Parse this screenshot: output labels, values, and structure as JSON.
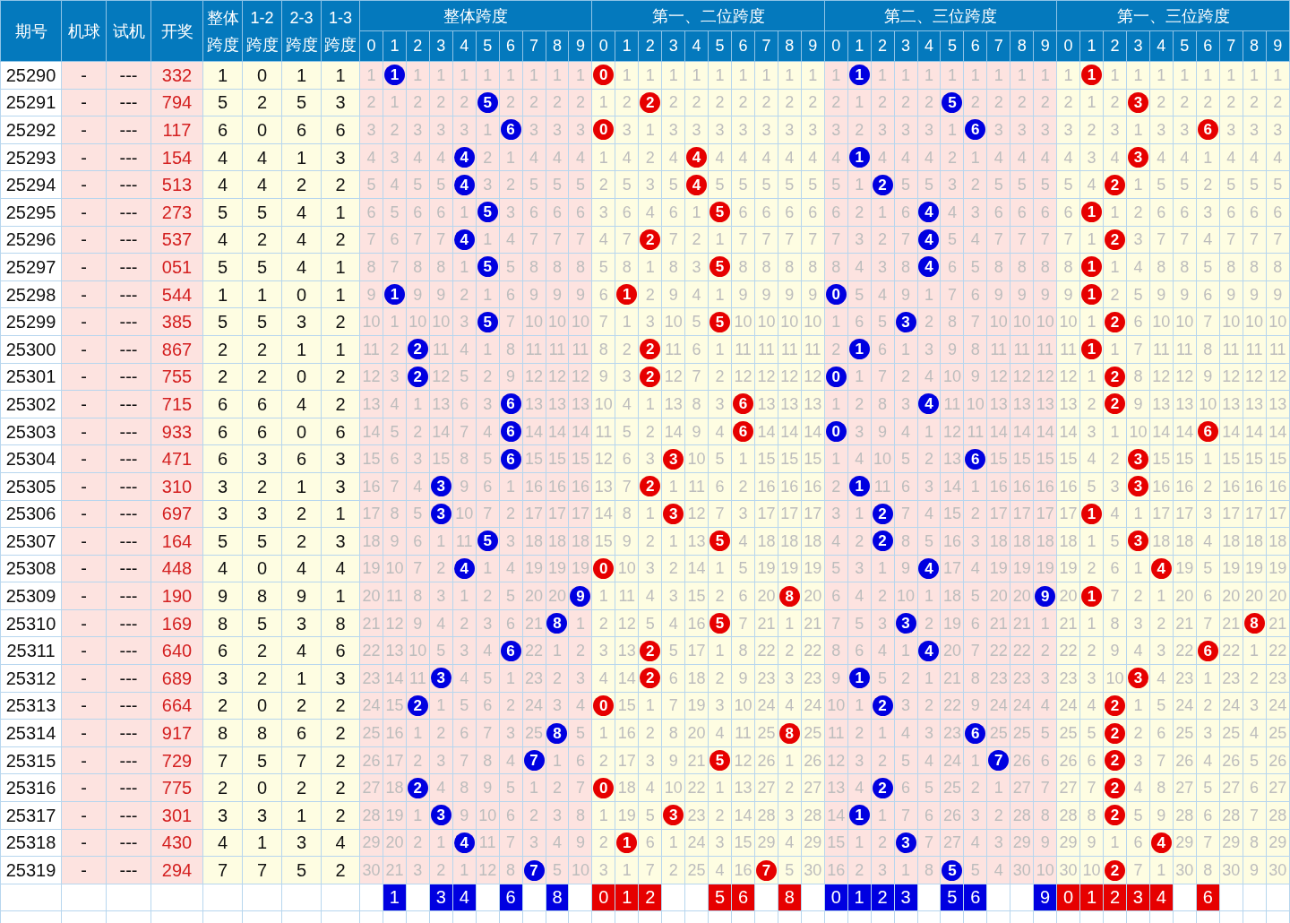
{
  "columns": [
    {
      "label": "期号"
    },
    {
      "label": "机球"
    },
    {
      "label": "试机"
    },
    {
      "label": "开奖"
    }
  ],
  "span_columns": [
    {
      "top": "整体",
      "bottom": "跨度"
    },
    {
      "top": "1-2",
      "bottom": "跨度"
    },
    {
      "top": "2-3",
      "bottom": "跨度"
    },
    {
      "top": "1-3",
      "bottom": "跨度"
    }
  ],
  "groups": [
    {
      "title": "整体跨度",
      "color": "#0000e0",
      "digits": [
        "0",
        "1",
        "2",
        "3",
        "4",
        "5",
        "6",
        "7",
        "8",
        "9"
      ],
      "picks": [
        {
          "kind": "blank"
        },
        {
          "kind": "digit",
          "digit": "1"
        },
        {
          "kind": "blank"
        },
        {
          "kind": "digit",
          "digit": "3"
        },
        {
          "kind": "digit",
          "digit": "4"
        },
        {
          "kind": "blank"
        },
        {
          "kind": "digit",
          "digit": "6"
        },
        {
          "kind": "blank"
        },
        {
          "kind": "digit",
          "digit": "8"
        },
        {
          "kind": "blank"
        }
      ]
    },
    {
      "title": "第一、二位跨度",
      "color": "#e60000",
      "digits": [
        "0",
        "1",
        "2",
        "3",
        "4",
        "5",
        "6",
        "7",
        "8",
        "9"
      ],
      "picks": [
        {
          "kind": "digit",
          "digit": "0"
        },
        {
          "kind": "digit",
          "digit": "1"
        },
        {
          "kind": "digit",
          "digit": "2"
        },
        {
          "kind": "blank"
        },
        {
          "kind": "blank"
        },
        {
          "kind": "digit",
          "digit": "5"
        },
        {
          "kind": "digit",
          "digit": "6"
        },
        {
          "kind": "blank"
        },
        {
          "kind": "digit",
          "digit": "8"
        },
        {
          "kind": "blank"
        }
      ]
    },
    {
      "title": "第二、三位跨度",
      "color": "#0000e0",
      "digits": [
        "0",
        "1",
        "2",
        "3",
        "4",
        "5",
        "6",
        "7",
        "8",
        "9"
      ],
      "picks": [
        {
          "kind": "digit",
          "digit": "0"
        },
        {
          "kind": "digit",
          "digit": "1"
        },
        {
          "kind": "digit",
          "digit": "2"
        },
        {
          "kind": "digit",
          "digit": "3"
        },
        {
          "kind": "blank"
        },
        {
          "kind": "digit",
          "digit": "5"
        },
        {
          "kind": "digit",
          "digit": "6"
        },
        {
          "kind": "blank"
        },
        {
          "kind": "blank"
        },
        {
          "kind": "digit",
          "digit": "9"
        }
      ]
    },
    {
      "title": "第一、三位跨度",
      "color": "#e60000",
      "digits": [
        "0",
        "1",
        "2",
        "3",
        "4",
        "5",
        "6",
        "7",
        "8",
        "9"
      ],
      "picks": [
        {
          "kind": "digit",
          "digit": "0"
        },
        {
          "kind": "digit",
          "digit": "1"
        },
        {
          "kind": "digit",
          "digit": "2"
        },
        {
          "kind": "digit",
          "digit": "3"
        },
        {
          "kind": "digit",
          "digit": "4"
        },
        {
          "kind": "blank"
        },
        {
          "kind": "digit",
          "digit": "6"
        },
        {
          "kind": "blank"
        },
        {
          "kind": "blank"
        },
        {
          "kind": "blank"
        }
      ]
    }
  ],
  "rows": [
    {
      "issue": "25290",
      "machine": "-",
      "test": "---",
      "draw": "332",
      "spans": [
        "1",
        "0",
        "1",
        "1"
      ],
      "g": [
        [
          "1",
          {
            "ball": "1"
          },
          "1",
          "1",
          "1",
          "1",
          "1",
          "1",
          "1",
          "1"
        ],
        [
          {
            "ball": "0"
          },
          "1",
          "1",
          "1",
          "1",
          "1",
          "1",
          "1",
          "1",
          "1"
        ],
        [
          "1",
          {
            "ball": "1"
          },
          "1",
          "1",
          "1",
          "1",
          "1",
          "1",
          "1",
          "1"
        ],
        [
          "1",
          {
            "ball": "1"
          },
          "1",
          "1",
          "1",
          "1",
          "1",
          "1",
          "1",
          "1"
        ]
      ]
    },
    {
      "issue": "25291",
      "machine": "-",
      "test": "---",
      "draw": "794",
      "spans": [
        "5",
        "2",
        "5",
        "3"
      ],
      "g": [
        [
          "2",
          "1",
          "2",
          "2",
          "2",
          {
            "ball": "5"
          },
          "2",
          "2",
          "2",
          "2"
        ],
        [
          "1",
          "2",
          {
            "ball": "2"
          },
          "2",
          "2",
          "2",
          "2",
          "2",
          "2",
          "2"
        ],
        [
          "2",
          "1",
          "2",
          "2",
          "2",
          {
            "ball": "5"
          },
          "2",
          "2",
          "2",
          "2"
        ],
        [
          "2",
          "1",
          "2",
          {
            "ball": "3"
          },
          "2",
          "2",
          "2",
          "2",
          "2",
          "2"
        ]
      ]
    },
    {
      "issue": "25292",
      "machine": "-",
      "test": "---",
      "draw": "117",
      "spans": [
        "6",
        "0",
        "6",
        "6"
      ],
      "g": [
        [
          "3",
          "2",
          "3",
          "3",
          "3",
          "1",
          {
            "ball": "6"
          },
          "3",
          "3",
          "3"
        ],
        [
          {
            "ball": "0"
          },
          "3",
          "1",
          "3",
          "3",
          "3",
          "3",
          "3",
          "3",
          "3"
        ],
        [
          "3",
          "2",
          "3",
          "3",
          "3",
          "1",
          {
            "ball": "6"
          },
          "3",
          "3",
          "3"
        ],
        [
          "3",
          "2",
          "3",
          "1",
          "3",
          "3",
          {
            "ball": "6"
          },
          "3",
          "3",
          "3"
        ]
      ]
    },
    {
      "issue": "25293",
      "machine": "-",
      "test": "---",
      "draw": "154",
      "spans": [
        "4",
        "4",
        "1",
        "3"
      ],
      "g": [
        [
          "4",
          "3",
          "4",
          "4",
          {
            "ball": "4"
          },
          "2",
          "1",
          "4",
          "4",
          "4"
        ],
        [
          "1",
          "4",
          "2",
          "4",
          {
            "ball": "4"
          },
          "4",
          "4",
          "4",
          "4",
          "4"
        ],
        [
          "4",
          {
            "ball": "1"
          },
          "4",
          "4",
          "4",
          "2",
          "1",
          "4",
          "4",
          "4"
        ],
        [
          "4",
          "3",
          "4",
          {
            "ball": "3"
          },
          "4",
          "4",
          "1",
          "4",
          "4",
          "4"
        ]
      ]
    },
    {
      "issue": "25294",
      "machine": "-",
      "test": "---",
      "draw": "513",
      "spans": [
        "4",
        "4",
        "2",
        "2"
      ],
      "g": [
        [
          "5",
          "4",
          "5",
          "5",
          {
            "ball": "4"
          },
          "3",
          "2",
          "5",
          "5",
          "5"
        ],
        [
          "2",
          "5",
          "3",
          "5",
          {
            "ball": "4"
          },
          "5",
          "5",
          "5",
          "5",
          "5"
        ],
        [
          "5",
          "1",
          {
            "ball": "2"
          },
          "5",
          "5",
          "3",
          "2",
          "5",
          "5",
          "5"
        ],
        [
          "5",
          "4",
          {
            "ball": "2"
          },
          "1",
          "5",
          "5",
          "2",
          "5",
          "5",
          "5"
        ]
      ]
    },
    {
      "issue": "25295",
      "machine": "-",
      "test": "---",
      "draw": "273",
      "spans": [
        "5",
        "5",
        "4",
        "1"
      ],
      "g": [
        [
          "6",
          "5",
          "6",
          "6",
          "1",
          {
            "ball": "5"
          },
          "3",
          "6",
          "6",
          "6"
        ],
        [
          "3",
          "6",
          "4",
          "6",
          "1",
          {
            "ball": "5"
          },
          "6",
          "6",
          "6",
          "6"
        ],
        [
          "6",
          "2",
          "1",
          "6",
          {
            "ball": "4"
          },
          "4",
          "3",
          "6",
          "6",
          "6"
        ],
        [
          "6",
          {
            "ball": "1"
          },
          "1",
          "2",
          "6",
          "6",
          "3",
          "6",
          "6",
          "6"
        ]
      ]
    },
    {
      "issue": "25296",
      "machine": "-",
      "test": "---",
      "draw": "537",
      "spans": [
        "4",
        "2",
        "4",
        "2"
      ],
      "g": [
        [
          "7",
          "6",
          "7",
          "7",
          {
            "ball": "4"
          },
          "1",
          "4",
          "7",
          "7",
          "7"
        ],
        [
          "4",
          "7",
          {
            "ball": "2"
          },
          "7",
          "2",
          "1",
          "7",
          "7",
          "7",
          "7"
        ],
        [
          "7",
          "3",
          "2",
          "7",
          {
            "ball": "4"
          },
          "5",
          "4",
          "7",
          "7",
          "7"
        ],
        [
          "7",
          "1",
          {
            "ball": "2"
          },
          "3",
          "7",
          "7",
          "4",
          "7",
          "7",
          "7"
        ]
      ]
    },
    {
      "issue": "25297",
      "machine": "-",
      "test": "---",
      "draw": "051",
      "spans": [
        "5",
        "5",
        "4",
        "1"
      ],
      "g": [
        [
          "8",
          "7",
          "8",
          "8",
          "1",
          {
            "ball": "5"
          },
          "5",
          "8",
          "8",
          "8"
        ],
        [
          "5",
          "8",
          "1",
          "8",
          "3",
          {
            "ball": "5"
          },
          "8",
          "8",
          "8",
          "8"
        ],
        [
          "8",
          "4",
          "3",
          "8",
          {
            "ball": "4"
          },
          "6",
          "5",
          "8",
          "8",
          "8"
        ],
        [
          "8",
          {
            "ball": "1"
          },
          "1",
          "4",
          "8",
          "8",
          "5",
          "8",
          "8",
          "8"
        ]
      ]
    },
    {
      "issue": "25298",
      "machine": "-",
      "test": "---",
      "draw": "544",
      "spans": [
        "1",
        "1",
        "0",
        "1"
      ],
      "g": [
        [
          "9",
          {
            "ball": "1"
          },
          "9",
          "9",
          "2",
          "1",
          "6",
          "9",
          "9",
          "9"
        ],
        [
          "6",
          {
            "ball": "1"
          },
          "2",
          "9",
          "4",
          "1",
          "9",
          "9",
          "9",
          "9"
        ],
        [
          {
            "ball": "0"
          },
          "5",
          "4",
          "9",
          "1",
          "7",
          "6",
          "9",
          "9",
          "9"
        ],
        [
          "9",
          {
            "ball": "1"
          },
          "2",
          "5",
          "9",
          "9",
          "6",
          "9",
          "9",
          "9"
        ]
      ]
    },
    {
      "issue": "25299",
      "machine": "-",
      "test": "---",
      "draw": "385",
      "spans": [
        "5",
        "5",
        "3",
        "2"
      ],
      "g": [
        [
          "10",
          "1",
          "10",
          "10",
          "3",
          {
            "ball": "5"
          },
          "7",
          "10",
          "10",
          "10"
        ],
        [
          "7",
          "1",
          "3",
          "10",
          "5",
          {
            "ball": "5"
          },
          "10",
          "10",
          "10",
          "10"
        ],
        [
          "1",
          "6",
          "5",
          {
            "ball": "3"
          },
          "2",
          "8",
          "7",
          "10",
          "10",
          "10"
        ],
        [
          "10",
          "1",
          {
            "ball": "2"
          },
          "6",
          "10",
          "10",
          "7",
          "10",
          "10",
          "10"
        ]
      ]
    },
    {
      "issue": "25300",
      "machine": "-",
      "test": "---",
      "draw": "867",
      "spans": [
        "2",
        "2",
        "1",
        "1"
      ],
      "g": [
        [
          "11",
          "2",
          {
            "ball": "2"
          },
          "11",
          "4",
          "1",
          "8",
          "11",
          "11",
          "11"
        ],
        [
          "8",
          "2",
          {
            "ball": "2"
          },
          "11",
          "6",
          "1",
          "11",
          "11",
          "11",
          "11"
        ],
        [
          "2",
          {
            "ball": "1"
          },
          "6",
          "1",
          "3",
          "9",
          "8",
          "11",
          "11",
          "11"
        ],
        [
          "11",
          {
            "ball": "1"
          },
          "1",
          "7",
          "11",
          "11",
          "8",
          "11",
          "11",
          "11"
        ]
      ]
    },
    {
      "issue": "25301",
      "machine": "-",
      "test": "---",
      "draw": "755",
      "spans": [
        "2",
        "2",
        "0",
        "2"
      ],
      "g": [
        [
          "12",
          "3",
          {
            "ball": "2"
          },
          "12",
          "5",
          "2",
          "9",
          "12",
          "12",
          "12"
        ],
        [
          "9",
          "3",
          {
            "ball": "2"
          },
          "12",
          "7",
          "2",
          "12",
          "12",
          "12",
          "12"
        ],
        [
          {
            "ball": "0"
          },
          "1",
          "7",
          "2",
          "4",
          "10",
          "9",
          "12",
          "12",
          "12"
        ],
        [
          "12",
          "1",
          {
            "ball": "2"
          },
          "8",
          "12",
          "12",
          "9",
          "12",
          "12",
          "12"
        ]
      ]
    },
    {
      "issue": "25302",
      "machine": "-",
      "test": "---",
      "draw": "715",
      "spans": [
        "6",
        "6",
        "4",
        "2"
      ],
      "g": [
        [
          "13",
          "4",
          "1",
          "13",
          "6",
          "3",
          {
            "ball": "6"
          },
          "13",
          "13",
          "13"
        ],
        [
          "10",
          "4",
          "1",
          "13",
          "8",
          "3",
          {
            "ball": "6"
          },
          "13",
          "13",
          "13"
        ],
        [
          "1",
          "2",
          "8",
          "3",
          {
            "ball": "4"
          },
          "11",
          "10",
          "13",
          "13",
          "13"
        ],
        [
          "13",
          "2",
          {
            "ball": "2"
          },
          "9",
          "13",
          "13",
          "10",
          "13",
          "13",
          "13"
        ]
      ]
    },
    {
      "issue": "25303",
      "machine": "-",
      "test": "---",
      "draw": "933",
      "spans": [
        "6",
        "6",
        "0",
        "6"
      ],
      "g": [
        [
          "14",
          "5",
          "2",
          "14",
          "7",
          "4",
          {
            "ball": "6"
          },
          "14",
          "14",
          "14"
        ],
        [
          "11",
          "5",
          "2",
          "14",
          "9",
          "4",
          {
            "ball": "6"
          },
          "14",
          "14",
          "14"
        ],
        [
          {
            "ball": "0"
          },
          "3",
          "9",
          "4",
          "1",
          "12",
          "11",
          "14",
          "14",
          "14"
        ],
        [
          "14",
          "3",
          "1",
          "10",
          "14",
          "14",
          {
            "ball": "6"
          },
          "14",
          "14",
          "14"
        ]
      ]
    },
    {
      "issue": "25304",
      "machine": "-",
      "test": "---",
      "draw": "471",
      "spans": [
        "6",
        "3",
        "6",
        "3"
      ],
      "g": [
        [
          "15",
          "6",
          "3",
          "15",
          "8",
          "5",
          {
            "ball": "6"
          },
          "15",
          "15",
          "15"
        ],
        [
          "12",
          "6",
          "3",
          {
            "ball": "3"
          },
          "10",
          "5",
          "1",
          "15",
          "15",
          "15"
        ],
        [
          "1",
          "4",
          "10",
          "5",
          "2",
          "13",
          {
            "ball": "6"
          },
          "15",
          "15",
          "15"
        ],
        [
          "15",
          "4",
          "2",
          {
            "ball": "3"
          },
          "15",
          "15",
          "1",
          "15",
          "15",
          "15"
        ]
      ]
    },
    {
      "issue": "25305",
      "machine": "-",
      "test": "---",
      "draw": "310",
      "spans": [
        "3",
        "2",
        "1",
        "3"
      ],
      "g": [
        [
          "16",
          "7",
          "4",
          {
            "ball": "3"
          },
          "9",
          "6",
          "1",
          "16",
          "16",
          "16"
        ],
        [
          "13",
          "7",
          {
            "ball": "2"
          },
          "1",
          "11",
          "6",
          "2",
          "16",
          "16",
          "16"
        ],
        [
          "2",
          {
            "ball": "1"
          },
          "11",
          "6",
          "3",
          "14",
          "1",
          "16",
          "16",
          "16"
        ],
        [
          "16",
          "5",
          "3",
          {
            "ball": "3"
          },
          "16",
          "16",
          "2",
          "16",
          "16",
          "16"
        ]
      ]
    },
    {
      "issue": "25306",
      "machine": "-",
      "test": "---",
      "draw": "697",
      "spans": [
        "3",
        "3",
        "2",
        "1"
      ],
      "g": [
        [
          "17",
          "8",
          "5",
          {
            "ball": "3"
          },
          "10",
          "7",
          "2",
          "17",
          "17",
          "17"
        ],
        [
          "14",
          "8",
          "1",
          {
            "ball": "3"
          },
          "12",
          "7",
          "3",
          "17",
          "17",
          "17"
        ],
        [
          "3",
          "1",
          {
            "ball": "2"
          },
          "7",
          "4",
          "15",
          "2",
          "17",
          "17",
          "17"
        ],
        [
          "17",
          {
            "ball": "1"
          },
          "4",
          "1",
          "17",
          "17",
          "3",
          "17",
          "17",
          "17"
        ]
      ]
    },
    {
      "issue": "25307",
      "machine": "-",
      "test": "---",
      "draw": "164",
      "spans": [
        "5",
        "5",
        "2",
        "3"
      ],
      "g": [
        [
          "18",
          "9",
          "6",
          "1",
          "11",
          {
            "ball": "5"
          },
          "3",
          "18",
          "18",
          "18"
        ],
        [
          "15",
          "9",
          "2",
          "1",
          "13",
          {
            "ball": "5"
          },
          "4",
          "18",
          "18",
          "18"
        ],
        [
          "4",
          "2",
          {
            "ball": "2"
          },
          "8",
          "5",
          "16",
          "3",
          "18",
          "18",
          "18"
        ],
        [
          "18",
          "1",
          "5",
          {
            "ball": "3"
          },
          "18",
          "18",
          "4",
          "18",
          "18",
          "18"
        ]
      ]
    },
    {
      "issue": "25308",
      "machine": "-",
      "test": "---",
      "draw": "448",
      "spans": [
        "4",
        "0",
        "4",
        "4"
      ],
      "g": [
        [
          "19",
          "10",
          "7",
          "2",
          {
            "ball": "4"
          },
          "1",
          "4",
          "19",
          "19",
          "19"
        ],
        [
          {
            "ball": "0"
          },
          "10",
          "3",
          "2",
          "14",
          "1",
          "5",
          "19",
          "19",
          "19"
        ],
        [
          "5",
          "3",
          "1",
          "9",
          {
            "ball": "4"
          },
          "17",
          "4",
          "19",
          "19",
          "19"
        ],
        [
          "19",
          "2",
          "6",
          "1",
          {
            "ball": "4"
          },
          "19",
          "5",
          "19",
          "19",
          "19"
        ]
      ]
    },
    {
      "issue": "25309",
      "machine": "-",
      "test": "---",
      "draw": "190",
      "spans": [
        "9",
        "8",
        "9",
        "1"
      ],
      "g": [
        [
          "20",
          "11",
          "8",
          "3",
          "1",
          "2",
          "5",
          "20",
          "20",
          {
            "ball": "9"
          }
        ],
        [
          "1",
          "11",
          "4",
          "3",
          "15",
          "2",
          "6",
          "20",
          {
            "ball": "8"
          },
          "20"
        ],
        [
          "6",
          "4",
          "2",
          "10",
          "1",
          "18",
          "5",
          "20",
          "20",
          {
            "ball": "9"
          }
        ],
        [
          "20",
          {
            "ball": "1"
          },
          "7",
          "2",
          "1",
          "20",
          "6",
          "20",
          "20",
          "20"
        ]
      ]
    },
    {
      "issue": "25310",
      "machine": "-",
      "test": "---",
      "draw": "169",
      "spans": [
        "8",
        "5",
        "3",
        "8"
      ],
      "g": [
        [
          "21",
          "12",
          "9",
          "4",
          "2",
          "3",
          "6",
          "21",
          {
            "ball": "8"
          },
          "1"
        ],
        [
          "2",
          "12",
          "5",
          "4",
          "16",
          {
            "ball": "5"
          },
          "7",
          "21",
          "1",
          "21"
        ],
        [
          "7",
          "5",
          "3",
          {
            "ball": "3"
          },
          "2",
          "19",
          "6",
          "21",
          "21",
          "1"
        ],
        [
          "21",
          "1",
          "8",
          "3",
          "2",
          "21",
          "7",
          "21",
          {
            "ball": "8"
          },
          "21"
        ]
      ]
    },
    {
      "issue": "25311",
      "machine": "-",
      "test": "---",
      "draw": "640",
      "spans": [
        "6",
        "2",
        "4",
        "6"
      ],
      "g": [
        [
          "22",
          "13",
          "10",
          "5",
          "3",
          "4",
          {
            "ball": "6"
          },
          "22",
          "1",
          "2"
        ],
        [
          "3",
          "13",
          {
            "ball": "2"
          },
          "5",
          "17",
          "1",
          "8",
          "22",
          "2",
          "22"
        ],
        [
          "8",
          "6",
          "4",
          "1",
          {
            "ball": "4"
          },
          "20",
          "7",
          "22",
          "22",
          "2"
        ],
        [
          "22",
          "2",
          "9",
          "4",
          "3",
          "22",
          {
            "ball": "6"
          },
          "22",
          "1",
          "22"
        ]
      ]
    },
    {
      "issue": "25312",
      "machine": "-",
      "test": "---",
      "draw": "689",
      "spans": [
        "3",
        "2",
        "1",
        "3"
      ],
      "g": [
        [
          "23",
          "14",
          "11",
          {
            "ball": "3"
          },
          "4",
          "5",
          "1",
          "23",
          "2",
          "3"
        ],
        [
          "4",
          "14",
          {
            "ball": "2"
          },
          "6",
          "18",
          "2",
          "9",
          "23",
          "3",
          "23"
        ],
        [
          "9",
          {
            "ball": "1"
          },
          "5",
          "2",
          "1",
          "21",
          "8",
          "23",
          "23",
          "3"
        ],
        [
          "23",
          "3",
          "10",
          {
            "ball": "3"
          },
          "4",
          "23",
          "1",
          "23",
          "2",
          "23"
        ]
      ]
    },
    {
      "issue": "25313",
      "machine": "-",
      "test": "---",
      "draw": "664",
      "spans": [
        "2",
        "0",
        "2",
        "2"
      ],
      "g": [
        [
          "24",
          "15",
          {
            "ball": "2"
          },
          "1",
          "5",
          "6",
          "2",
          "24",
          "3",
          "4"
        ],
        [
          {
            "ball": "0"
          },
          "15",
          "1",
          "7",
          "19",
          "3",
          "10",
          "24",
          "4",
          "24"
        ],
        [
          "10",
          "1",
          {
            "ball": "2"
          },
          "3",
          "2",
          "22",
          "9",
          "24",
          "24",
          "4"
        ],
        [
          "24",
          "4",
          {
            "ball": "2"
          },
          "1",
          "5",
          "24",
          "2",
          "24",
          "3",
          "24"
        ]
      ]
    },
    {
      "issue": "25314",
      "machine": "-",
      "test": "---",
      "draw": "917",
      "spans": [
        "8",
        "8",
        "6",
        "2"
      ],
      "g": [
        [
          "25",
          "16",
          "1",
          "2",
          "6",
          "7",
          "3",
          "25",
          {
            "ball": "8"
          },
          "5"
        ],
        [
          "1",
          "16",
          "2",
          "8",
          "20",
          "4",
          "11",
          "25",
          {
            "ball": "8"
          },
          "25"
        ],
        [
          "11",
          "2",
          "1",
          "4",
          "3",
          "23",
          {
            "ball": "6"
          },
          "25",
          "25",
          "5"
        ],
        [
          "25",
          "5",
          {
            "ball": "2"
          },
          "2",
          "6",
          "25",
          "3",
          "25",
          "4",
          "25"
        ]
      ]
    },
    {
      "issue": "25315",
      "machine": "-",
      "test": "---",
      "draw": "729",
      "spans": [
        "7",
        "5",
        "7",
        "2"
      ],
      "g": [
        [
          "26",
          "17",
          "2",
          "3",
          "7",
          "8",
          "4",
          {
            "ball": "7"
          },
          "1",
          "6"
        ],
        [
          "2",
          "17",
          "3",
          "9",
          "21",
          {
            "ball": "5"
          },
          "12",
          "26",
          "1",
          "26"
        ],
        [
          "12",
          "3",
          "2",
          "5",
          "4",
          "24",
          "1",
          {
            "ball": "7"
          },
          "26",
          "6"
        ],
        [
          "26",
          "6",
          {
            "ball": "2"
          },
          "3",
          "7",
          "26",
          "4",
          "26",
          "5",
          "26"
        ]
      ]
    },
    {
      "issue": "25316",
      "machine": "-",
      "test": "---",
      "draw": "775",
      "spans": [
        "2",
        "0",
        "2",
        "2"
      ],
      "g": [
        [
          "27",
          "18",
          {
            "ball": "2"
          },
          "4",
          "8",
          "9",
          "5",
          "1",
          "2",
          "7"
        ],
        [
          {
            "ball": "0"
          },
          "18",
          "4",
          "10",
          "22",
          "1",
          "13",
          "27",
          "2",
          "27"
        ],
        [
          "13",
          "4",
          {
            "ball": "2"
          },
          "6",
          "5",
          "25",
          "2",
          "1",
          "27",
          "7"
        ],
        [
          "27",
          "7",
          {
            "ball": "2"
          },
          "4",
          "8",
          "27",
          "5",
          "27",
          "6",
          "27"
        ]
      ]
    },
    {
      "issue": "25317",
      "machine": "-",
      "test": "---",
      "draw": "301",
      "spans": [
        "3",
        "3",
        "1",
        "2"
      ],
      "g": [
        [
          "28",
          "19",
          "1",
          {
            "ball": "3"
          },
          "9",
          "10",
          "6",
          "2",
          "3",
          "8"
        ],
        [
          "1",
          "19",
          "5",
          {
            "ball": "3"
          },
          "23",
          "2",
          "14",
          "28",
          "3",
          "28"
        ],
        [
          "14",
          {
            "ball": "1"
          },
          "1",
          "7",
          "6",
          "26",
          "3",
          "2",
          "28",
          "8"
        ],
        [
          "28",
          "8",
          {
            "ball": "2"
          },
          "5",
          "9",
          "28",
          "6",
          "28",
          "7",
          "28"
        ]
      ]
    },
    {
      "issue": "25318",
      "machine": "-",
      "test": "---",
      "draw": "430",
      "spans": [
        "4",
        "1",
        "3",
        "4"
      ],
      "g": [
        [
          "29",
          "20",
          "2",
          "1",
          {
            "ball": "4"
          },
          "11",
          "7",
          "3",
          "4",
          "9"
        ],
        [
          "2",
          {
            "ball": "1"
          },
          "6",
          "1",
          "24",
          "3",
          "15",
          "29",
          "4",
          "29"
        ],
        [
          "15",
          "1",
          "2",
          {
            "ball": "3"
          },
          "7",
          "27",
          "4",
          "3",
          "29",
          "9"
        ],
        [
          "29",
          "9",
          "1",
          "6",
          {
            "ball": "4"
          },
          "29",
          "7",
          "29",
          "8",
          "29"
        ]
      ]
    },
    {
      "issue": "25319",
      "machine": "-",
      "test": "---",
      "draw": "294",
      "spans": [
        "7",
        "7",
        "5",
        "2"
      ],
      "g": [
        [
          "30",
          "21",
          "3",
          "2",
          "1",
          "12",
          "8",
          {
            "ball": "7"
          },
          "5",
          "10"
        ],
        [
          "3",
          "1",
          "7",
          "2",
          "25",
          "4",
          "16",
          {
            "ball": "7"
          },
          "5",
          "30"
        ],
        [
          "16",
          "2",
          "3",
          "1",
          "8",
          {
            "ball": "5"
          },
          "5",
          "4",
          "30",
          "10"
        ],
        [
          "30",
          "10",
          {
            "ball": "2"
          },
          "7",
          "1",
          "30",
          "8",
          "30",
          "9",
          "30"
        ]
      ]
    }
  ]
}
